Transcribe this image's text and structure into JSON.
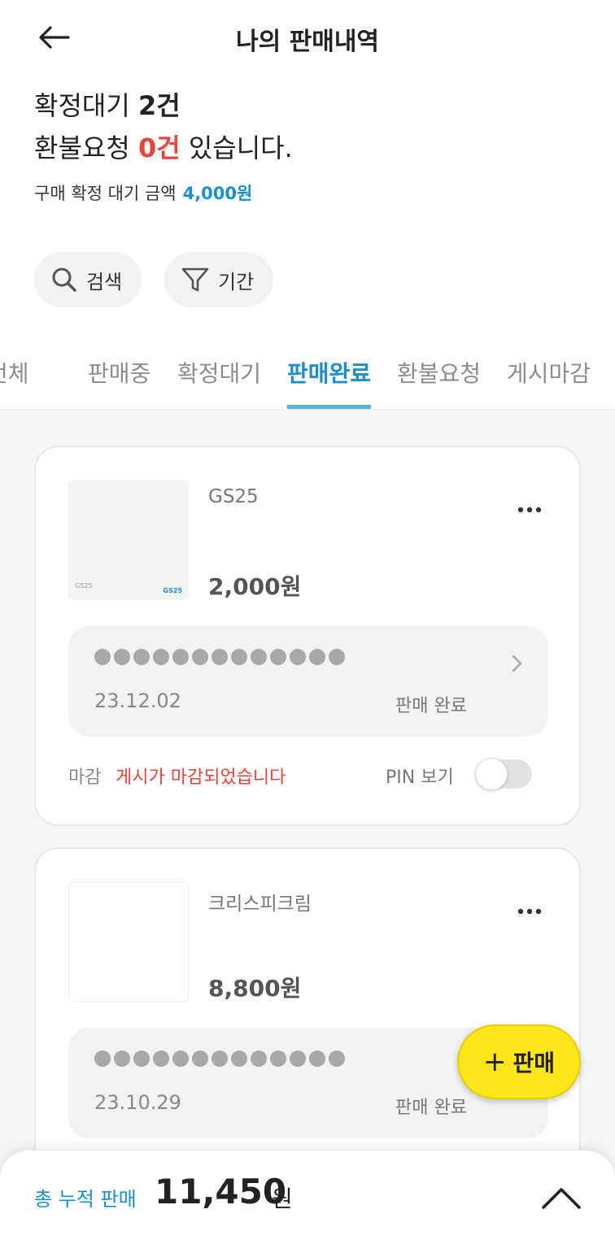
{
  "header": {
    "title": "나의 판매내역"
  },
  "summary": {
    "line1_prefix": "확정대기",
    "line1_count": "2건",
    "line2_prefix": "환불요청",
    "line2_count": "0건",
    "line2_suffix": "있습니다.",
    "pending_label": "구매 확정 대기 금액",
    "pending_amount": "4,000원"
  },
  "filters": {
    "search_label": "검색",
    "period_label": "기간"
  },
  "tabs": [
    {
      "label": "전체"
    },
    {
      "label": "판매중"
    },
    {
      "label": "확정대기"
    },
    {
      "label": "판매완료",
      "active": true
    },
    {
      "label": "환불요청"
    },
    {
      "label": "게시마감"
    }
  ],
  "items": [
    {
      "brand": "GS25",
      "price": "2,000원",
      "thumb_brand": "GS25",
      "thumb_logo": "GS25",
      "date": "23.12.02",
      "status": "판매 완료",
      "close_label": "마감",
      "close_message": "게시가 마감되었습니다",
      "pin_label": "PIN 보기",
      "pin_visible": false
    },
    {
      "brand": "크리스피크림",
      "price": "8,800원",
      "date": "23.10.29",
      "status": "판매 완료"
    }
  ],
  "fab": {
    "label": "판매",
    "plus": "+"
  },
  "bottom": {
    "total_label": "총 누적 판매",
    "total_value": "11,450",
    "total_unit": "원"
  },
  "colors": {
    "accent": "#1b8ecb",
    "alert": "#e8453c",
    "fab": "#ffe51a"
  },
  "icons": [
    "back-arrow-icon",
    "search-icon",
    "filter-icon",
    "more-icon",
    "chevron-right-icon",
    "chevron-up-icon"
  ]
}
